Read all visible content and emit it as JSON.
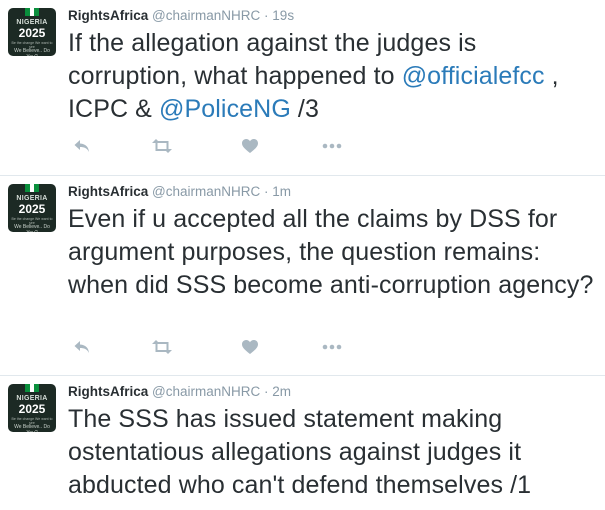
{
  "avatar": {
    "line1": "NIGERIA",
    "line2": "2025",
    "line3": "Be the change We want to see",
    "line4": "We Believe.. Do You?"
  },
  "tweets": [
    {
      "name": "RightsAfrica",
      "handle": "@chairmanNHRC",
      "dot": "·",
      "time": "19s",
      "text": [
        {
          "t": "If the allegation against the judges is corruption, what happened to "
        },
        {
          "t": "@officialefcc",
          "mention": true
        },
        {
          "t": " , ICPC & "
        },
        {
          "t": "@PoliceNG",
          "mention": true
        },
        {
          "t": " /3"
        }
      ]
    },
    {
      "name": "RightsAfrica",
      "handle": "@chairmanNHRC",
      "dot": "·",
      "time": "1m",
      "text": [
        {
          "t": "Even if u accepted all the claims by DSS for argument purposes, the question remains: when did SSS become anti-corruption agency?"
        }
      ]
    },
    {
      "name": "RightsAfrica",
      "handle": "@chairmanNHRC",
      "dot": "·",
      "time": "2m",
      "text": [
        {
          "t": "The SSS has issued statement making ostentatious allegations against judges it abducted who can't defend themselves /1"
        }
      ]
    }
  ],
  "icons": {
    "reply": "reply-icon",
    "retweet": "retweet-icon",
    "like": "heart-icon",
    "more": "more-icon"
  },
  "colors": {
    "mention": "#2b7bb9",
    "text": "#292f33",
    "meta": "#8899a6",
    "icon": "#aab8c2",
    "divider": "#e1e8ed"
  }
}
